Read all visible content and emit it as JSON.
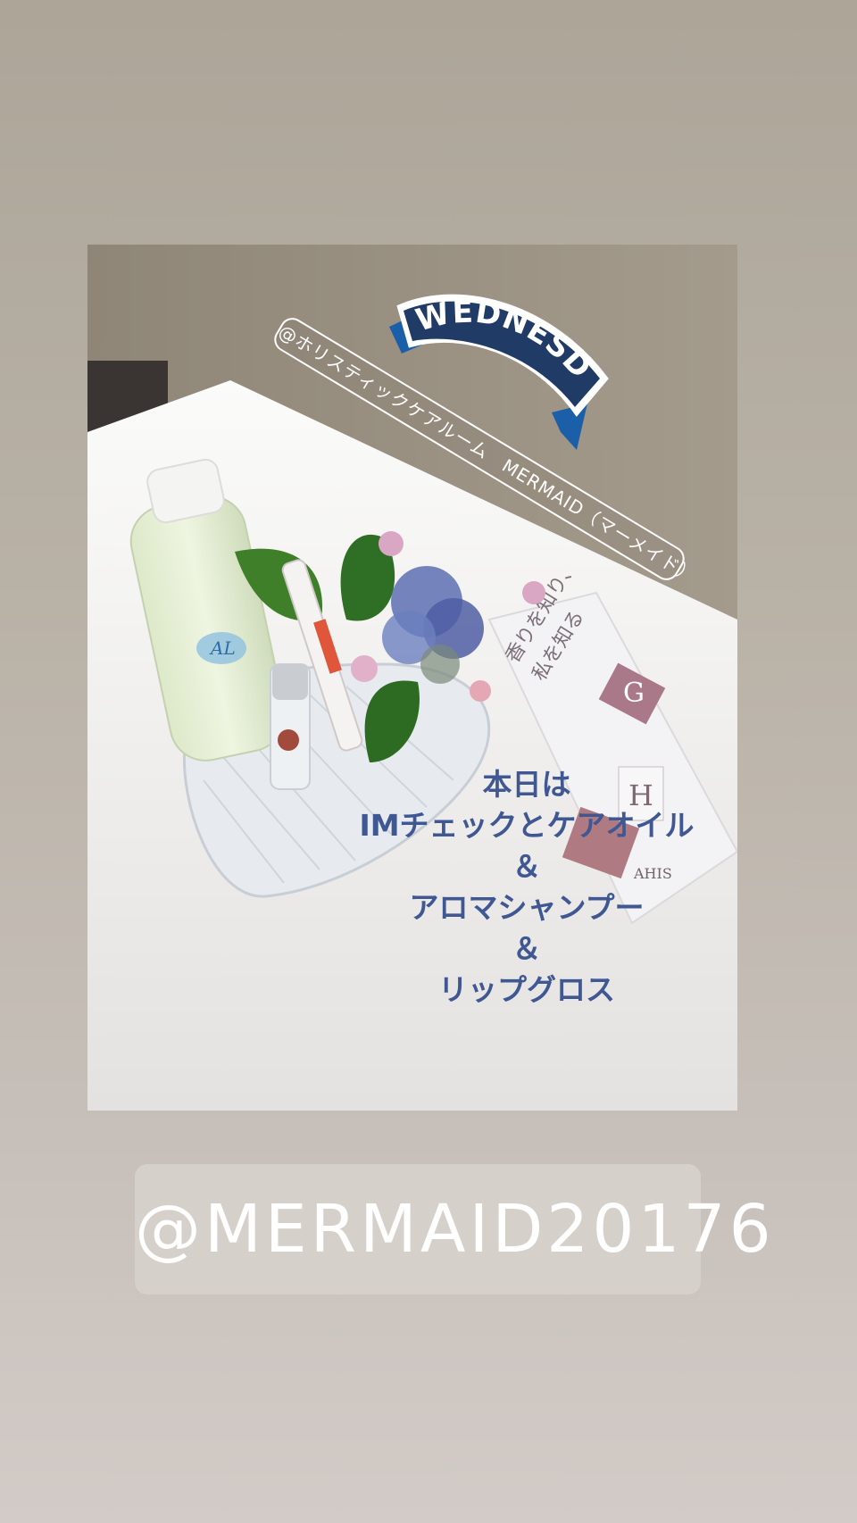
{
  "background": {
    "top_color": "#aca598",
    "bottom_color": "#d2cbc7"
  },
  "photo": {
    "wednesday_sticker": {
      "text": "WEDNESDAY",
      "ribbon_color": "#1a5fa8",
      "banner_color": "#1f3b66"
    },
    "mention_tag": {
      "text": "@ホリスティックケアルーム　MERMAID（マーメイド）"
    },
    "products": {
      "bottle_logo": "AL",
      "leaflet_lines": [
        "香りを知り、",
        "私を知る"
      ],
      "leaflet_letters": [
        "G",
        "H"
      ],
      "leaflet_brand": "AHIS"
    },
    "caption": {
      "color": "#3f5792",
      "lines": [
        "本日は",
        "IMチェックとケアオイル",
        "＆",
        "アロマシャンプー",
        "＆",
        "リップグロス"
      ]
    }
  },
  "handle_sticker": {
    "text": "@MERMAID20176"
  }
}
